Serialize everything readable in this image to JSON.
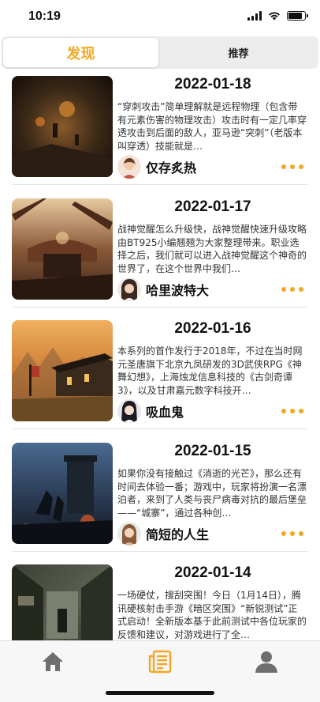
{
  "status_bar": {
    "time": "10:19",
    "battery_level": 0.85
  },
  "tabs": [
    {
      "label": "发现",
      "active": true
    },
    {
      "label": "推荐",
      "active": false
    }
  ],
  "colors": {
    "accent": "#f6a623",
    "divider": "#e2e2e2"
  },
  "articles": [
    {
      "date": "2022-01-18",
      "excerpt": "“穿刺攻击”简单理解就是远程物理（包含带有元素伤害的物理攻击）攻击时有一定几率穿透攻击到后面的敌人，亚马逊“突刺”（老版本叫穿透）技能就是…",
      "author": "仅存炙热",
      "more_icon": "more-dots-icon"
    },
    {
      "date": "2022-01-17",
      "excerpt": "战神觉醒怎么升级快，战神觉醒快速升级攻略由BT925小编翘翘为大家整理带来。职业选择之后，我们就可以进入战神觉醒这个神奇的世界了，在这个世界中我们…",
      "author": "哈里波特大",
      "more_icon": "more-dots-icon"
    },
    {
      "date": "2022-01-16",
      "excerpt": "本系列的首作发行于2018年，不过在当时网元圣唐旗下北京九凤研发的3D武侠RPG《神舞幻想》，上海烛龙信息科技的《古剑奇谭3》，以及甘肃嘉元数字科技开…",
      "author": "吸血鬼",
      "more_icon": "more-dots-icon"
    },
    {
      "date": "2022-01-15",
      "excerpt": "如果你没有接触过《消逝的光芒》，那么还有时间去体验一番；游戏中，玩家将扮演一名漂泊者，来到了人类与丧尸病毒对抗的最后堡垒——“城寨”，通过各种创…",
      "author": "简短的人生",
      "more_icon": "more-dots-icon"
    },
    {
      "date": "2022-01-14",
      "excerpt": "一场硬仗，搜刮突围！今日（1月14日），腾讯硬核射击手游《暗区突围》“新锐测试”正式启动！全新版本基于此前测试中各位玩家的反馈和建议，对游戏进行了全…",
      "author": "",
      "more_icon": "more-dots-icon"
    }
  ],
  "tabbar": [
    {
      "icon": "home-icon",
      "active": false
    },
    {
      "icon": "news-icon",
      "active": true
    },
    {
      "icon": "profile-icon",
      "active": false
    }
  ]
}
